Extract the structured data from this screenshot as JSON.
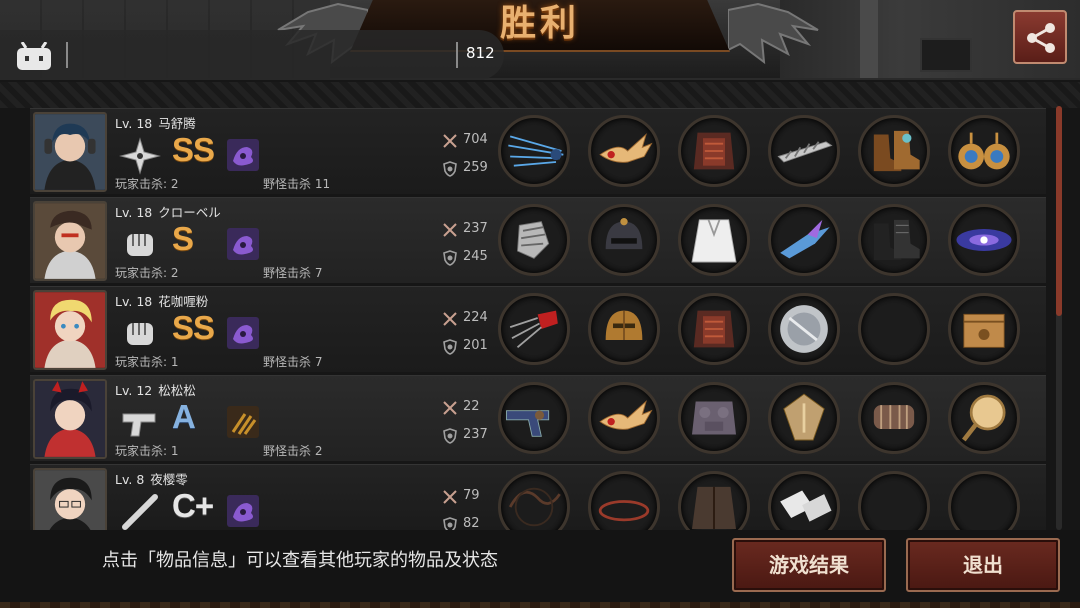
{
  "header": {
    "title": "胜利"
  },
  "overlay": {
    "count": "812",
    "tv_icon": "bilibili-tv-icon"
  },
  "share": {
    "icon": "share-icon"
  },
  "players": [
    {
      "level": "Lv. 18",
      "name": "马舒腾",
      "rank": "SS",
      "rank_color": "#e9a84a",
      "weapon": "shuriken-icon",
      "skill": "purple-skill-icon",
      "player_kills": "玩家击杀: 2",
      "monster_kills": "野怪击杀 11",
      "attack": "704",
      "defense": "259",
      "items": [
        "blue-claw-weapon-icon",
        "golden-wing-crown-icon",
        "red-armor-icon",
        "silver-feather-icon",
        "ornate-boots-icon",
        "gold-earrings-icon"
      ]
    },
    {
      "level": "Lv. 18",
      "name": "クローベル",
      "rank": "S",
      "rank_color": "#e9a84a",
      "weapon": "fist-icon",
      "skill": "purple-skill-icon",
      "player_kills": "玩家击杀: 2",
      "monster_kills": "野怪击杀 7",
      "attack": "237",
      "defense": "245",
      "items": [
        "steel-gauntlet-icon",
        "dark-helmet-icon",
        "white-robe-icon",
        "crystal-blade-icon",
        "black-boots-icon",
        "galaxy-orb-icon"
      ]
    },
    {
      "level": "Lv. 18",
      "name": "花咖喱粉",
      "rank": "SS",
      "rank_color": "#e9a84a",
      "weapon": "fist-icon",
      "skill": "purple-skill-icon",
      "player_kills": "玩家击杀: 1",
      "monster_kills": "野怪击杀 7",
      "attack": "224",
      "defense": "201",
      "items": [
        "red-claw-icon",
        "bronze-helmet-icon",
        "red-armor-icon",
        "silver-disc-icon",
        "empty-slot",
        "mystery-box-icon"
      ]
    },
    {
      "level": "Lv. 12",
      "name": "松松松",
      "rank": "A",
      "rank_color": "#86b2e0",
      "weapon": "pistol-icon",
      "skill": "bullets-skill-icon",
      "player_kills": "玩家击杀: 1",
      "monster_kills": "野怪击杀 2",
      "attack": "22",
      "defense": "237",
      "items": [
        "revolver-icon",
        "golden-wing-crown-icon",
        "stone-armor-icon",
        "golden-shield-icon",
        "arm-bracer-icon",
        "hand-mirror-icon"
      ]
    },
    {
      "level": "Lv. 8",
      "name": "夜樱零",
      "rank": "C+",
      "rank_color": "#e6e6e6",
      "weapon": "bat-icon",
      "skill": "purple-skill-icon",
      "player_kills": "",
      "monster_kills": "",
      "attack": "79",
      "defense": "82",
      "items": [
        "whip-icon",
        "ring-icon",
        "leather-jacket-icon",
        "bandage-hands-icon",
        "empty-slot",
        "empty-slot"
      ]
    }
  ],
  "footer": {
    "hint": "点击「物品信息」可以查看其他玩家的物品及状态",
    "result_button": "游戏结果",
    "exit_button": "退出"
  },
  "colors": {
    "accent": "#e8b070",
    "button": "#5a1e18",
    "scroll_thumb": "#8a3a2a"
  }
}
